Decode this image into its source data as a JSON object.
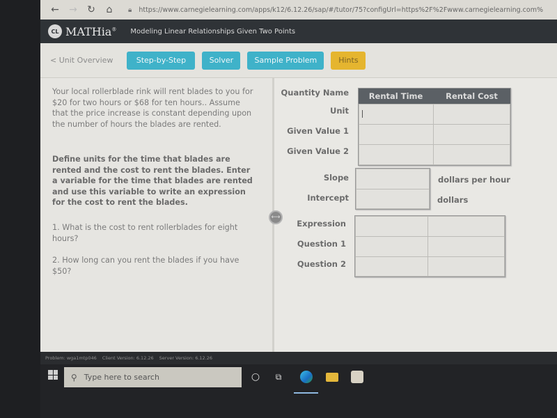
{
  "browser": {
    "back_icon": "arrow-left-icon",
    "forward_icon": "arrow-right-icon",
    "reload_icon": "reload-icon",
    "home_icon": "home-icon",
    "lock_icon": "lock-icon",
    "url": "https://www.carnegielearning.com/apps/k12/6.12.26/sap/#/tutor/75?configUrl=https%2F%2Fwww.carnegielearning.com%"
  },
  "app": {
    "logo_mark": "CL",
    "logo_name": "MATHia",
    "logo_reg": "®",
    "lesson_title": "Modeling Linear Relationships Given Two Points"
  },
  "toolbar": {
    "back_link": "< Unit Overview",
    "buttons": [
      {
        "label": "Step-by-Step",
        "color": "#3fb2c9"
      },
      {
        "label": "Solver",
        "color": "#3fb2c9"
      },
      {
        "label": "Sample Problem",
        "color": "#3fb2c9"
      },
      {
        "label": "Hints",
        "color": "#e5b52f"
      }
    ]
  },
  "problem": {
    "intro": "Your local rollerblade rink will rent blades to you for $20 for two hours or $68 for ten hours.. Assume that the price increase is constant depending upon the number of hours the blades are rented.",
    "instructions": "Define units for the time that blades are rented and the cost to rent the blades. Enter a variable for the time that blades are rented and use this variable to write an expression for the cost to rent the blades.",
    "question1": "1. What is the cost to rent rollerblades for eight hours?",
    "question2": "2. How long can you rent the blades if you have $50?"
  },
  "worksheet": {
    "quantity_name_label": "Quantity Name",
    "columns": [
      "Rental Time",
      "Rental Cost"
    ],
    "rows_top": [
      "Unit",
      "Given Value 1",
      "Given Value 2"
    ],
    "slope_label": "Slope",
    "slope_unit": "dollars per hour",
    "intercept_label": "Intercept",
    "intercept_unit": "dollars",
    "rows_bottom": [
      "Expression",
      "Question 1",
      "Question 2"
    ],
    "cells": {
      "unit_time": "",
      "unit_cost": "",
      "gv1_time": "",
      "gv1_cost": "",
      "gv2_time": "",
      "gv2_cost": "",
      "slope": "",
      "intercept": "",
      "expr_time": "",
      "expr_cost": "",
      "q1_time": "",
      "q1_cost": "",
      "q2_time": "",
      "q2_cost": ""
    }
  },
  "status": {
    "problem": "Problem: wga1mtp046",
    "client_version": "Client Version: 6.12.26",
    "server_version": "Server Version: 6.12.26"
  },
  "taskbar": {
    "search_placeholder": "Type here to search",
    "icons": [
      "windows-start-icon",
      "cortana-icon",
      "task-view-icon",
      "edge-icon",
      "file-explorer-icon",
      "store-icon"
    ]
  }
}
